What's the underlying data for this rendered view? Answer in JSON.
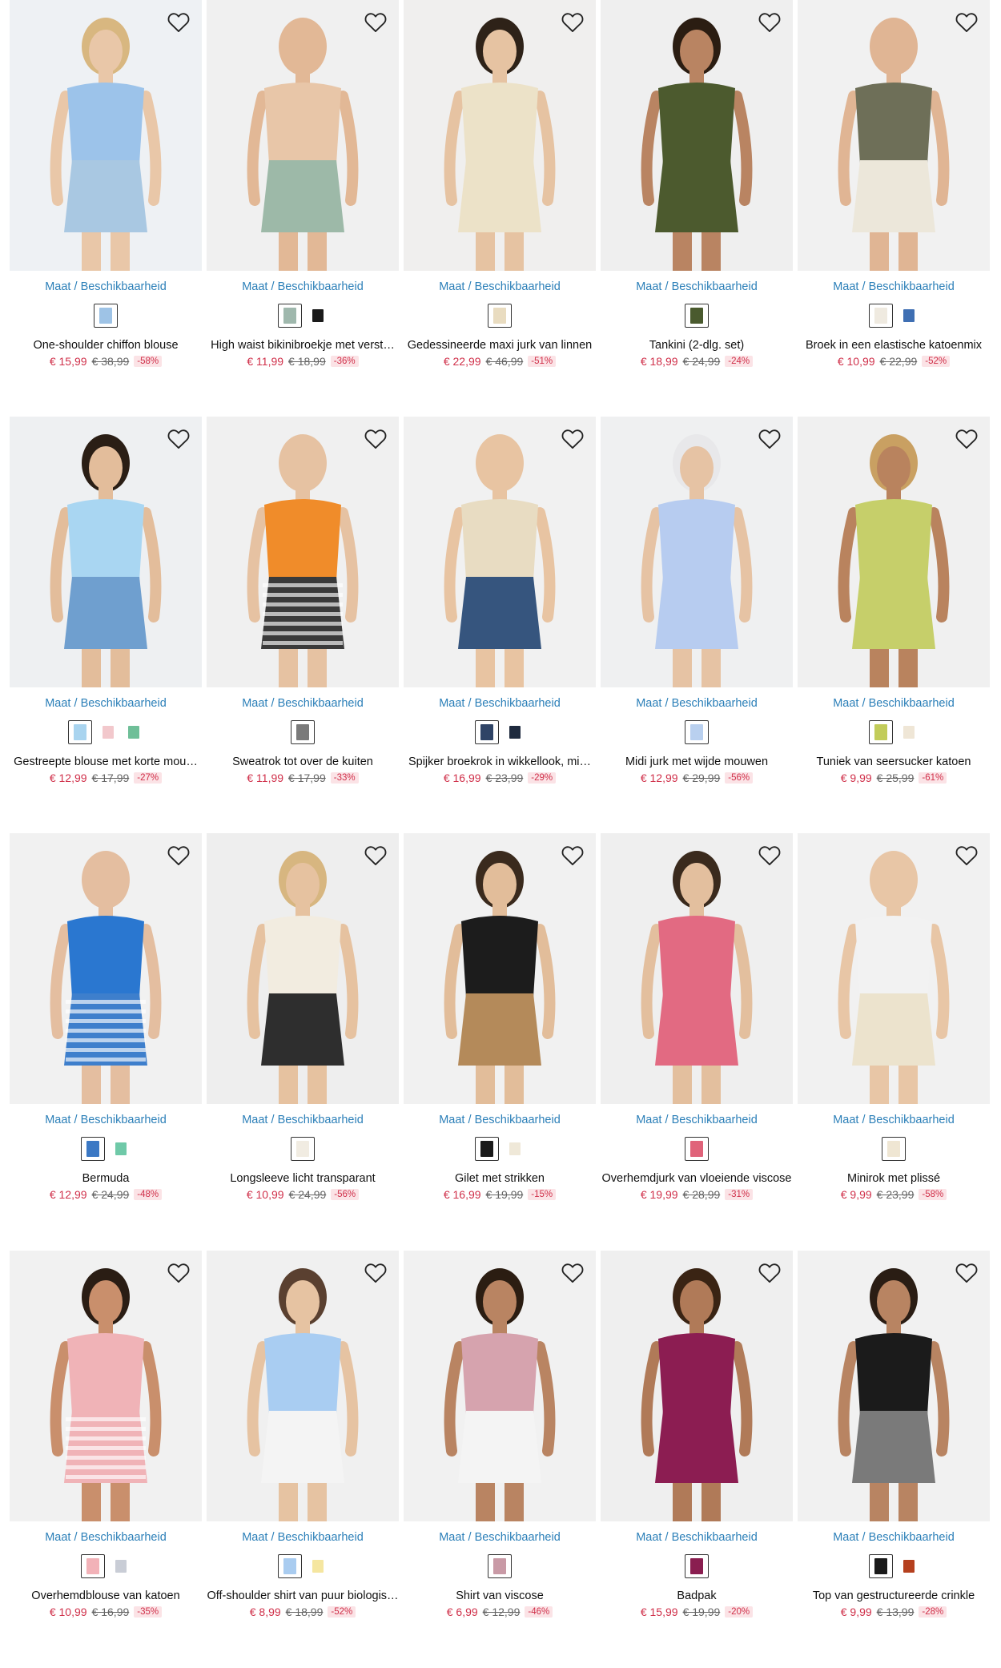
{
  "labels": {
    "maat": "Maat",
    "sep": " / ",
    "availability": "Beschikbaarheid"
  },
  "colors": {
    "link": "#2b7fb8",
    "price": "#d0304a",
    "discount_bg": "#fbe3e6"
  },
  "products": [
    {
      "name": "One-shoulder chiffon blouse",
      "price": "€ 15,99",
      "old": "€ 38,99",
      "disc": "-58%",
      "swatches": [
        "#9ec3e6"
      ],
      "look": {
        "bg": "#eef1f4",
        "top": "#9cc3ea",
        "bottom": "#a9c8e2",
        "skin": "#e9c7a8",
        "hair": "#d8b780"
      }
    },
    {
      "name": "High waist bikinibroekje met verst…",
      "price": "€ 11,99",
      "old": "€ 18,99",
      "disc": "-36%",
      "swatches": [
        "#9fb8ad",
        "#1a1a1a"
      ],
      "look": {
        "bg": "#f0f0f0",
        "top": "#e8c6a8",
        "bottom": "#9db9a8",
        "skin": "#e2b896",
        "hair": "#e2b896"
      }
    },
    {
      "name": "Gedessineerde maxi jurk van linnen",
      "price": "€ 22,99",
      "old": "€ 46,99",
      "disc": "-51%",
      "swatches": [
        "#e9dcc0"
      ],
      "look": {
        "bg": "#f0efee",
        "top": "#ece2c8",
        "bottom": "#ece2c8",
        "skin": "#e6c3a2",
        "hair": "#2e2218"
      }
    },
    {
      "name": "Tankini (2-dlg. set)",
      "price": "€ 18,99",
      "old": "€ 24,99",
      "disc": "-24%",
      "swatches": [
        "#4a5a2e"
      ],
      "look": {
        "bg": "#efefef",
        "top": "#4c5a2e",
        "bottom": "#4c5a2e",
        "skin": "#b98462",
        "hair": "#2b1d12"
      }
    },
    {
      "name": "Broek in een elastische katoenmix",
      "price": "€ 10,99",
      "old": "€ 22,99",
      "disc": "-52%",
      "swatches": [
        "#efeae0",
        "#3f6fb3"
      ],
      "look": {
        "bg": "#f1f1f1",
        "top": "#6e6f58",
        "bottom": "#ece7da",
        "skin": "#e0b594",
        "hair": "#e0b594"
      }
    },
    {
      "name": "Gestreepte blouse met korte mou…",
      "price": "€ 12,99",
      "old": "€ 17,99",
      "disc": "-27%",
      "swatches": [
        "#a9d4ef",
        "#f2c8cc",
        "#6fbf98"
      ],
      "look": {
        "bg": "#eef0f2",
        "top": "#a9d6f2",
        "bottom": "#6f9fcf",
        "skin": "#e3bd9b",
        "hair": "#2a1e15"
      }
    },
    {
      "name": "Sweatrok tot over de kuiten",
      "price": "€ 11,99",
      "old": "€ 17,99",
      "disc": "-33%",
      "swatches": [
        "#7a7a7a"
      ],
      "look": {
        "bg": "#f0f0f0",
        "top": "#f08c2a",
        "bottom": "#3a3a3a",
        "skin": "#e6c2a2",
        "hair": "#e6c2a2",
        "stripes": true
      }
    },
    {
      "name": "Spijker broekrok in wikkellook, mi…",
      "price": "€ 16,99",
      "old": "€ 23,99",
      "disc": "-29%",
      "swatches": [
        "#2f4466",
        "#1e2a3e"
      ],
      "look": {
        "bg": "#f1f1f1",
        "top": "#e8dcc2",
        "bottom": "#36557e",
        "skin": "#e8c4a2",
        "hair": "#e8c4a2"
      }
    },
    {
      "name": "Midi jurk met wijde mouwen",
      "price": "€ 12,99",
      "old": "€ 29,99",
      "disc": "-56%",
      "swatches": [
        "#b9d0ef"
      ],
      "look": {
        "bg": "#eff0f1",
        "top": "#b7ccf0",
        "bottom": "#b7ccf0",
        "skin": "#e6c3a4",
        "hair": "#e8e8ea"
      }
    },
    {
      "name": "Tuniek van seersucker katoen",
      "price": "€ 9,99",
      "old": "€ 25,99",
      "disc": "-61%",
      "swatches": [
        "#c2cc5a",
        "#efe6d6"
      ],
      "look": {
        "bg": "#f0f0f0",
        "top": "#c6cf6a",
        "bottom": "#c6cf6a",
        "skin": "#b9835e",
        "hair": "#c9a062"
      }
    },
    {
      "name": "Bermuda",
      "price": "€ 12,99",
      "old": "€ 24,99",
      "disc": "-48%",
      "swatches": [
        "#3b78c4",
        "#6fc9a8"
      ],
      "look": {
        "bg": "#f1f1f1",
        "top": "#2a77d0",
        "bottom": "#3e7fcc",
        "skin": "#e4bea0",
        "hair": "#e4bea0",
        "stripes": true
      }
    },
    {
      "name": "Longsleeve licht transparant",
      "price": "€ 10,99",
      "old": "€ 24,99",
      "disc": "-56%",
      "swatches": [
        "#f1ece2"
      ],
      "look": {
        "bg": "#eeeeee",
        "top": "#f2ece0",
        "bottom": "#2e2e2e",
        "skin": "#e6c2a0",
        "hair": "#d7b680"
      }
    },
    {
      "name": "Gilet met strikken",
      "price": "€ 16,99",
      "old": "€ 19,99",
      "disc": "-15%",
      "swatches": [
        "#1a1a1a",
        "#efe8d8"
      ],
      "look": {
        "bg": "#f1f1f1",
        "top": "#1c1c1c",
        "bottom": "#b48a5a",
        "skin": "#e2bd9a",
        "hair": "#3a2a1d"
      }
    },
    {
      "name": "Overhemdjurk van vloeiende viscose",
      "price": "€ 19,99",
      "old": "€ 28,99",
      "disc": "-31%",
      "swatches": [
        "#e0637a"
      ],
      "look": {
        "bg": "#efefef",
        "top": "#e26a82",
        "bottom": "#e26a82",
        "skin": "#e3bf9e",
        "hair": "#3a2a1d"
      }
    },
    {
      "name": "Minirok met plissé",
      "price": "€ 9,99",
      "old": "€ 23,99",
      "disc": "-58%",
      "swatches": [
        "#efe6d3"
      ],
      "look": {
        "bg": "#f1f1f1",
        "top": "#f2f2f2",
        "bottom": "#ece3cd",
        "skin": "#e8c6a6",
        "hair": "#e8c6a6"
      }
    },
    {
      "name": "Overhemdblouse van katoen",
      "price": "€ 10,99",
      "old": "€ 16,99",
      "disc": "-35%",
      "swatches": [
        "#f2b2b8",
        "#c9cdd6"
      ],
      "look": {
        "bg": "#f1f1f1",
        "top": "#f0b3b7",
        "bottom": "#f0b3b7",
        "skin": "#c98f6c",
        "hair": "#2a1d14",
        "stripes": true
      }
    },
    {
      "name": "Off-shoulder shirt van puur biologis…",
      "price": "€ 8,99",
      "old": "€ 18,99",
      "disc": "-52%",
      "swatches": [
        "#a9ccf0",
        "#f5e6a0"
      ],
      "look": {
        "bg": "#f0f0f0",
        "top": "#a9cdf2",
        "bottom": "#f4f4f4",
        "skin": "#e6c3a2",
        "hair": "#5a4030"
      }
    },
    {
      "name": "Shirt van viscose",
      "price": "€ 6,99",
      "old": "€ 12,99",
      "disc": "-46%",
      "swatches": [
        "#c99aa6"
      ],
      "look": {
        "bg": "#f1f1f1",
        "top": "#d6a3ae",
        "bottom": "#f4f4f4",
        "skin": "#b98462",
        "hair": "#2b1d12"
      }
    },
    {
      "name": "Badpak",
      "price": "€ 15,99",
      "old": "€ 19,99",
      "disc": "-20%",
      "swatches": [
        "#8a1e50"
      ],
      "look": {
        "bg": "#efefef",
        "top": "#8c1d52",
        "bottom": "#8c1d52",
        "skin": "#b07a58",
        "hair": "#3a2414"
      }
    },
    {
      "name": "Top van gestructureerde crinkle",
      "price": "€ 9,99",
      "old": "€ 13,99",
      "disc": "-28%",
      "swatches": [
        "#1a1a1a",
        "#b5401e"
      ],
      "look": {
        "bg": "#f1f1f1",
        "top": "#1b1b1b",
        "bottom": "#7a7a7a",
        "skin": "#b88462",
        "hair": "#2a1d14"
      }
    }
  ]
}
